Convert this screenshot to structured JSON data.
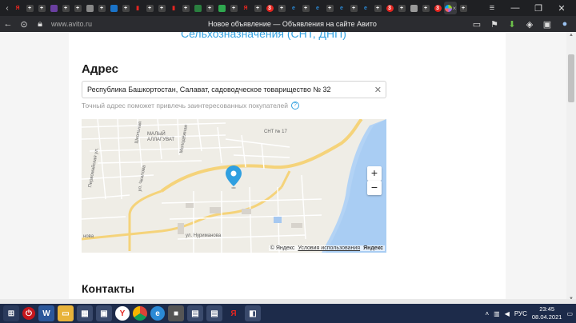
{
  "browser": {
    "url": "www.avito.ru",
    "page_title": "Новое объявление — Объявления на сайте Авито"
  },
  "section_prev": {
    "heading": "Сельхозназначения (СНТ, ДНП)"
  },
  "address_section": {
    "heading": "Адрес",
    "address_value": "Республика Башкортостан, Салават, садоводческое товарищество № 32",
    "hint": "Точный адрес поможет привлечь заинтересованных покупателей"
  },
  "map": {
    "labels": {
      "snt": "СНТ № 17",
      "malyi": "МАЛЫЙ АЛЛАГУВАТ",
      "street_nurimanova": "ул. Нуриманова",
      "nurimanova_left": "нова",
      "street_chkalova": "ул. Чкалова",
      "street_pervomaiskaya": "Первомайская ул.",
      "street_shkolnaya": "Школьная",
      "street_molodezhnaya": "Молодёжная"
    },
    "zoom_in": "+",
    "zoom_out": "−",
    "copyright": "© Яндекс",
    "terms": "Условия использования",
    "brand": "Яндекс"
  },
  "contacts_section": {
    "heading": "Контакты"
  },
  "taskbar": {
    "lang": "РУС",
    "time": "23:45",
    "date": "08.04.2021"
  },
  "colors": {
    "accent": "#32a1e0",
    "pin": "#2f9fe0"
  }
}
